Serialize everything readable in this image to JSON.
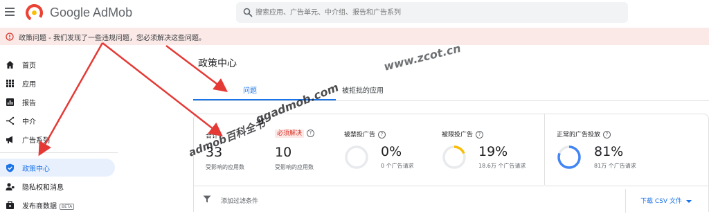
{
  "app": {
    "name": "Google AdMob",
    "logo_icon": "admob-logo-icon"
  },
  "search": {
    "placeholder": "搜索应用、广告单元、中介组、报告和广告系列"
  },
  "banner": {
    "text": "政策问题 - 我们发现了一些违规问题，您必须解决这些问题。",
    "icon": "warning-icon",
    "color": "#d93025"
  },
  "sidebar": {
    "items": [
      {
        "label": "首页",
        "icon": "home-icon"
      },
      {
        "label": "应用",
        "icon": "apps-icon"
      },
      {
        "label": "报告",
        "icon": "reports-icon"
      },
      {
        "label": "中介",
        "icon": "mediation-icon"
      },
      {
        "label": "广告系列",
        "icon": "campaign-icon"
      },
      {
        "label": "政策中心",
        "icon": "policy-shield-icon",
        "active": true
      },
      {
        "label": "隐私权和消息",
        "icon": "privacy-icon"
      },
      {
        "label": "发布商数据",
        "icon": "publisher-data-icon",
        "badge": "BETA"
      }
    ]
  },
  "main": {
    "title": "政策中心",
    "tabs": [
      {
        "label": "问题",
        "active": true
      },
      {
        "label": "被拒批的应用",
        "active": false
      }
    ],
    "stats": [
      {
        "label": "合计",
        "value": "33",
        "sub": "受影响的应用数"
      },
      {
        "label": "必须解决",
        "value": "10",
        "sub": "受影响的应用数"
      },
      {
        "label": "被禁投广告",
        "value": "0%",
        "sub": "0 个广告请求",
        "ring_fraction": 0,
        "ring_color": "#dadce0"
      },
      {
        "label": "被限投广告",
        "value": "19%",
        "sub": "18.6万 个广告请求",
        "ring_fraction": 0.19,
        "ring_color": "#fbbc04"
      },
      {
        "label": "正常的广告投放",
        "value": "81%",
        "sub": "81万 个广告请求",
        "ring_fraction": 0.81,
        "ring_color": "#4285f4"
      }
    ],
    "filter_label": "添加过滤条件",
    "download_label": "下载 CSV 文件"
  },
  "watermarks": {
    "zcot": "www.zcot.cn",
    "ggadmob": "ggadmob.com",
    "admob_wiki": "admob百科全书"
  },
  "colors": {
    "accent": "#1a73e8",
    "arrow": "#e53935",
    "banner_bg": "#fbe9e7"
  }
}
